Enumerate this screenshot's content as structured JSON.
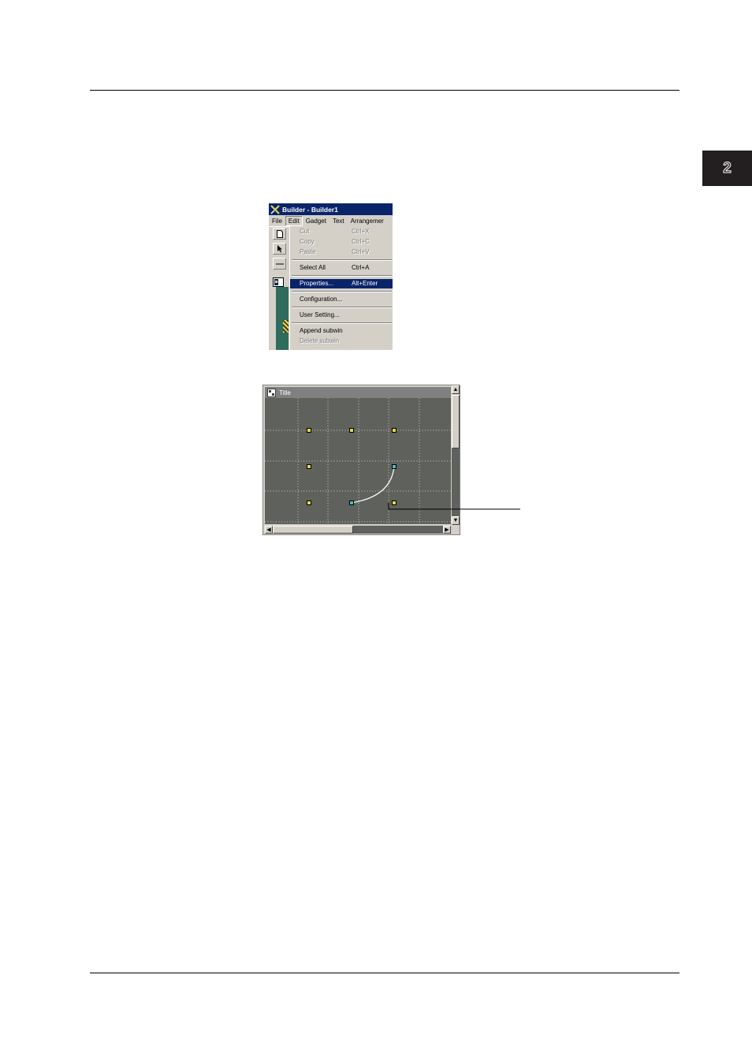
{
  "chapter": {
    "number": "2"
  },
  "builder_window": {
    "title": "Builder - Builder1",
    "menu": [
      "File",
      "Edit",
      "Gadget",
      "Text",
      "Arrangemer"
    ],
    "active_menu": "Edit",
    "edit_menu": {
      "groups": [
        [
          {
            "label": "Cut",
            "shortcut": "Ctrl+X",
            "enabled": false
          },
          {
            "label": "Copy",
            "shortcut": "Ctrl+C",
            "enabled": false
          },
          {
            "label": "Paste",
            "shortcut": "Ctrl+V",
            "enabled": false
          }
        ],
        [
          {
            "label": "Select All",
            "shortcut": "Ctrl+A",
            "enabled": true
          }
        ],
        [
          {
            "label": "Properties...",
            "shortcut": "Alt+Enter",
            "enabled": true,
            "selected": true
          }
        ],
        [
          {
            "label": "Configuration...",
            "shortcut": "",
            "enabled": true
          }
        ],
        [
          {
            "label": "User Setting...",
            "shortcut": "",
            "enabled": true
          }
        ],
        [
          {
            "label": "Append subwin",
            "shortcut": "",
            "enabled": true
          },
          {
            "label": "Delete subwin",
            "shortcut": "",
            "enabled": false
          }
        ]
      ]
    }
  },
  "drawing_window": {
    "title": "Title",
    "scroll_up": "▲",
    "scroll_down": "▼",
    "scroll_left": "◀",
    "scroll_right": "▶",
    "colors": {
      "canvas": "#5e615c",
      "gadget_handle": "#e7d84b",
      "endpoint_handle": "#45c0c0",
      "arc": "#ffffff"
    }
  }
}
